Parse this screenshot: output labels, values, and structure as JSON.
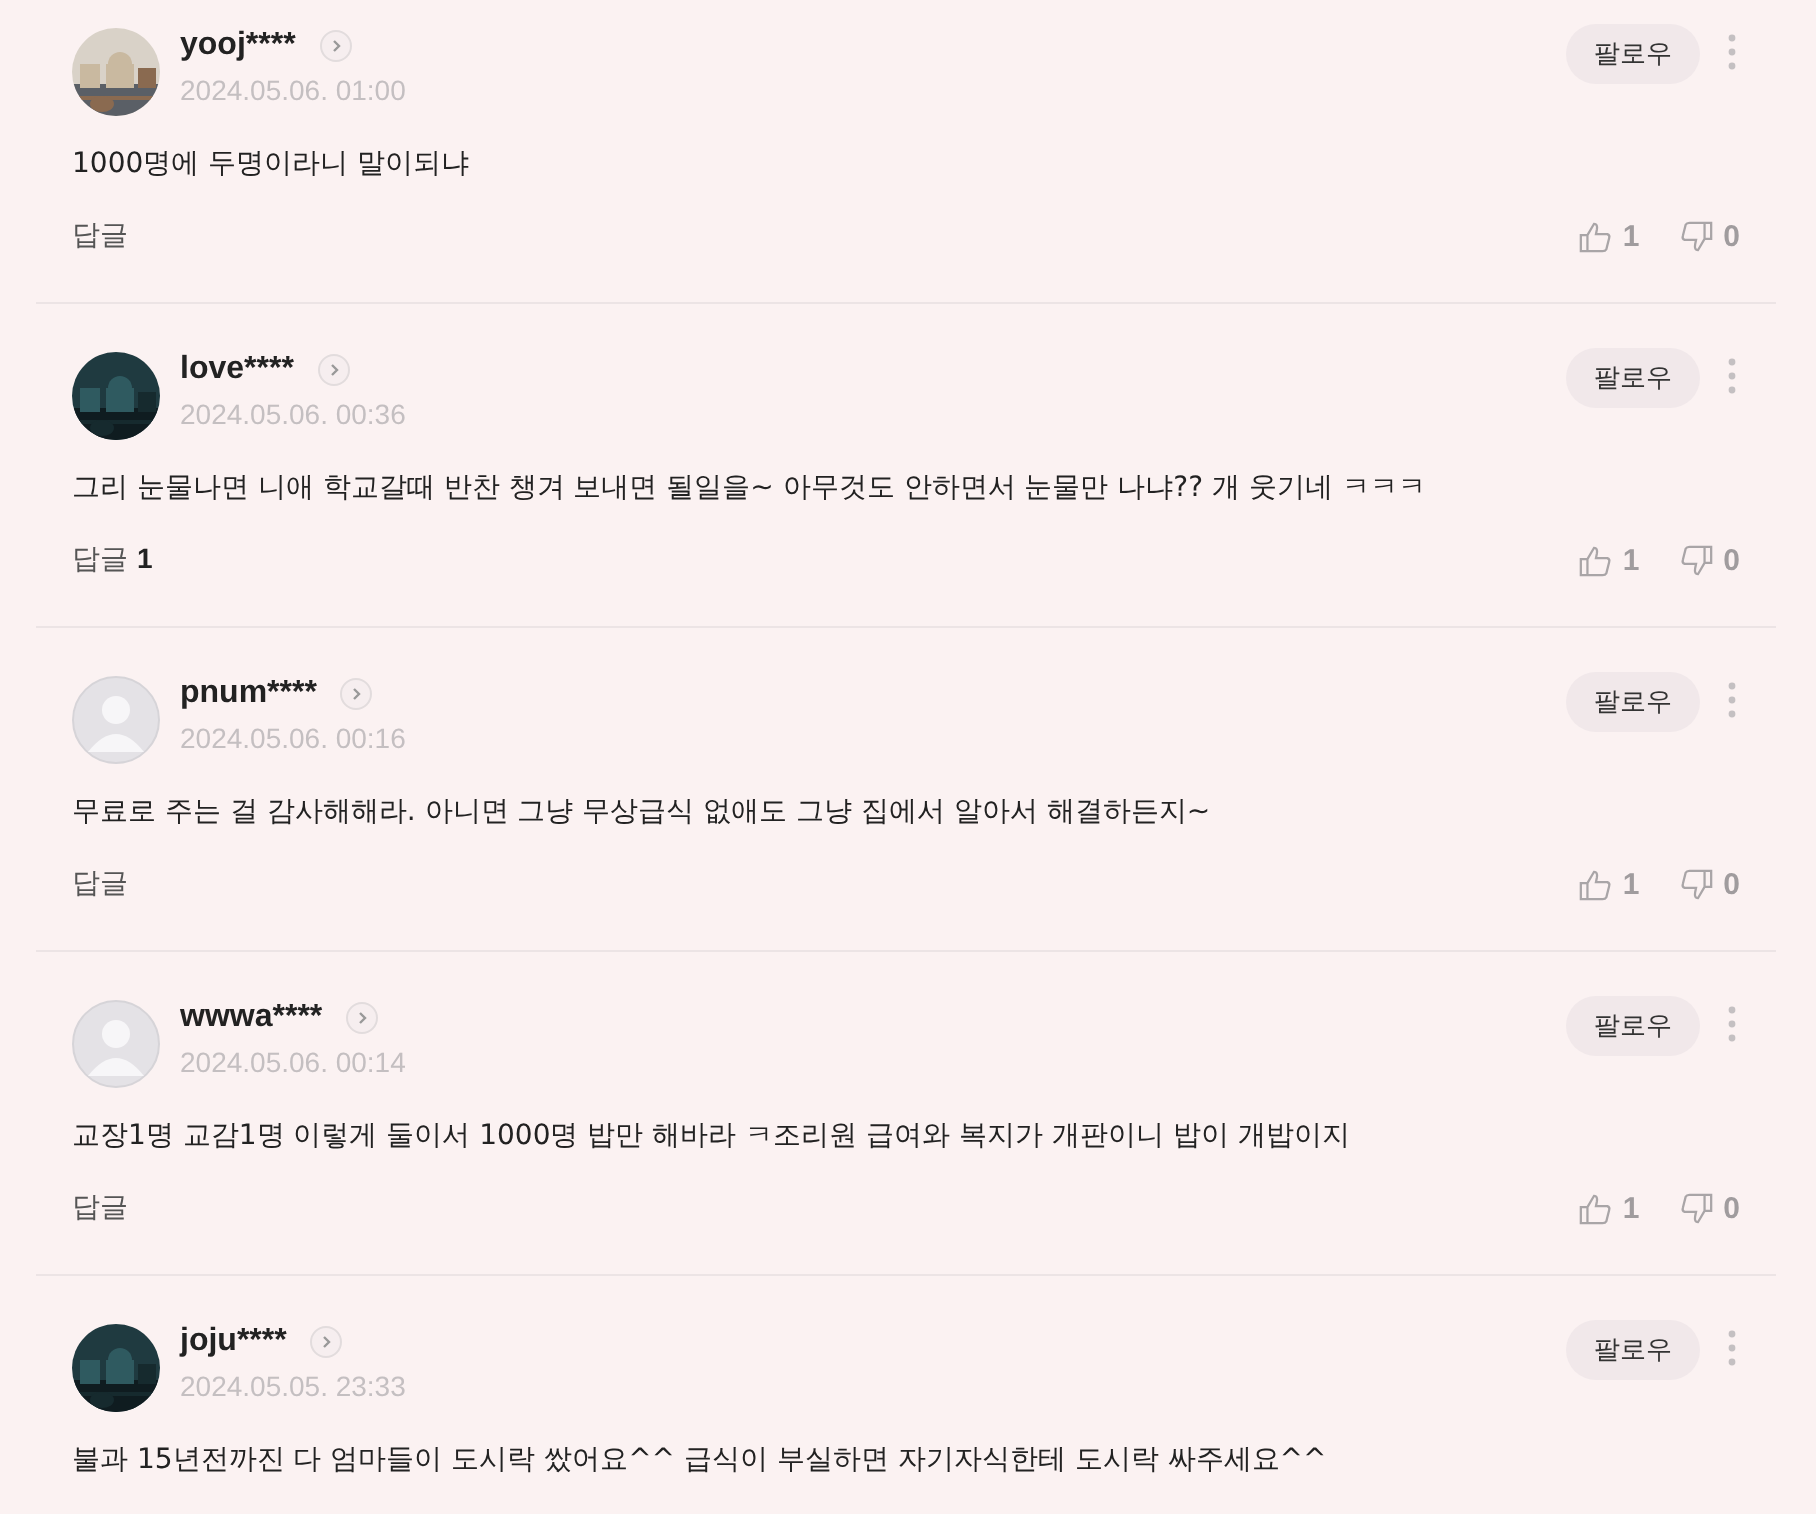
{
  "comments": [
    {
      "username": "yooj****",
      "date": "2024.05.06. 01:00",
      "follow_label": "팔로우",
      "text": "1000명에 두명이라니 말이되냐",
      "reply_label": "답글",
      "likes": "1",
      "dislikes": "0"
    },
    {
      "username": "love****",
      "date": "2024.05.06. 00:36",
      "follow_label": "팔로우",
      "text": "그리 눈물나면 니애 학교갈때 반찬 챙겨 보내면 될일을~ 아무것도 안하면서 눈물만 나냐?? 개 웃기네 ㅋㅋㅋ",
      "reply_label": "답글",
      "reply_count": "1",
      "likes": "1",
      "dislikes": "0"
    },
    {
      "username": "pnum****",
      "avatar": {
        "kind": "default"
      },
      "date": "2024.05.06. 00:16",
      "follow_label": "팔로우",
      "text": "무료로 주는 걸 감사해해라. 아니면 그냥 무상급식 없애도 그냥 집에서 알아서 해결하든지~",
      "reply_label": "답글",
      "likes": "1",
      "dislikes": "0"
    },
    {
      "username": "wwwa****",
      "avatar": {
        "kind": "default"
      },
      "date": "2024.05.06. 00:14",
      "follow_label": "팔로우",
      "text": "교장1명 교감1명 이렇게 둘이서 1000명 밥만 해바라 ㅋ조리원 급여와 복지가 개판이니 밥이 개밥이지",
      "reply_label": "답글",
      "likes": "1",
      "dislikes": "0"
    },
    {
      "username": "joju****",
      "date": "2024.05.05. 23:33",
      "follow_label": "팔로우",
      "text": "불과 15년전까진 다 엄마들이 도시락 쌌어요^^ 급식이 부실하면 자기자식한테 도시락 싸주세요^^"
    }
  ]
}
